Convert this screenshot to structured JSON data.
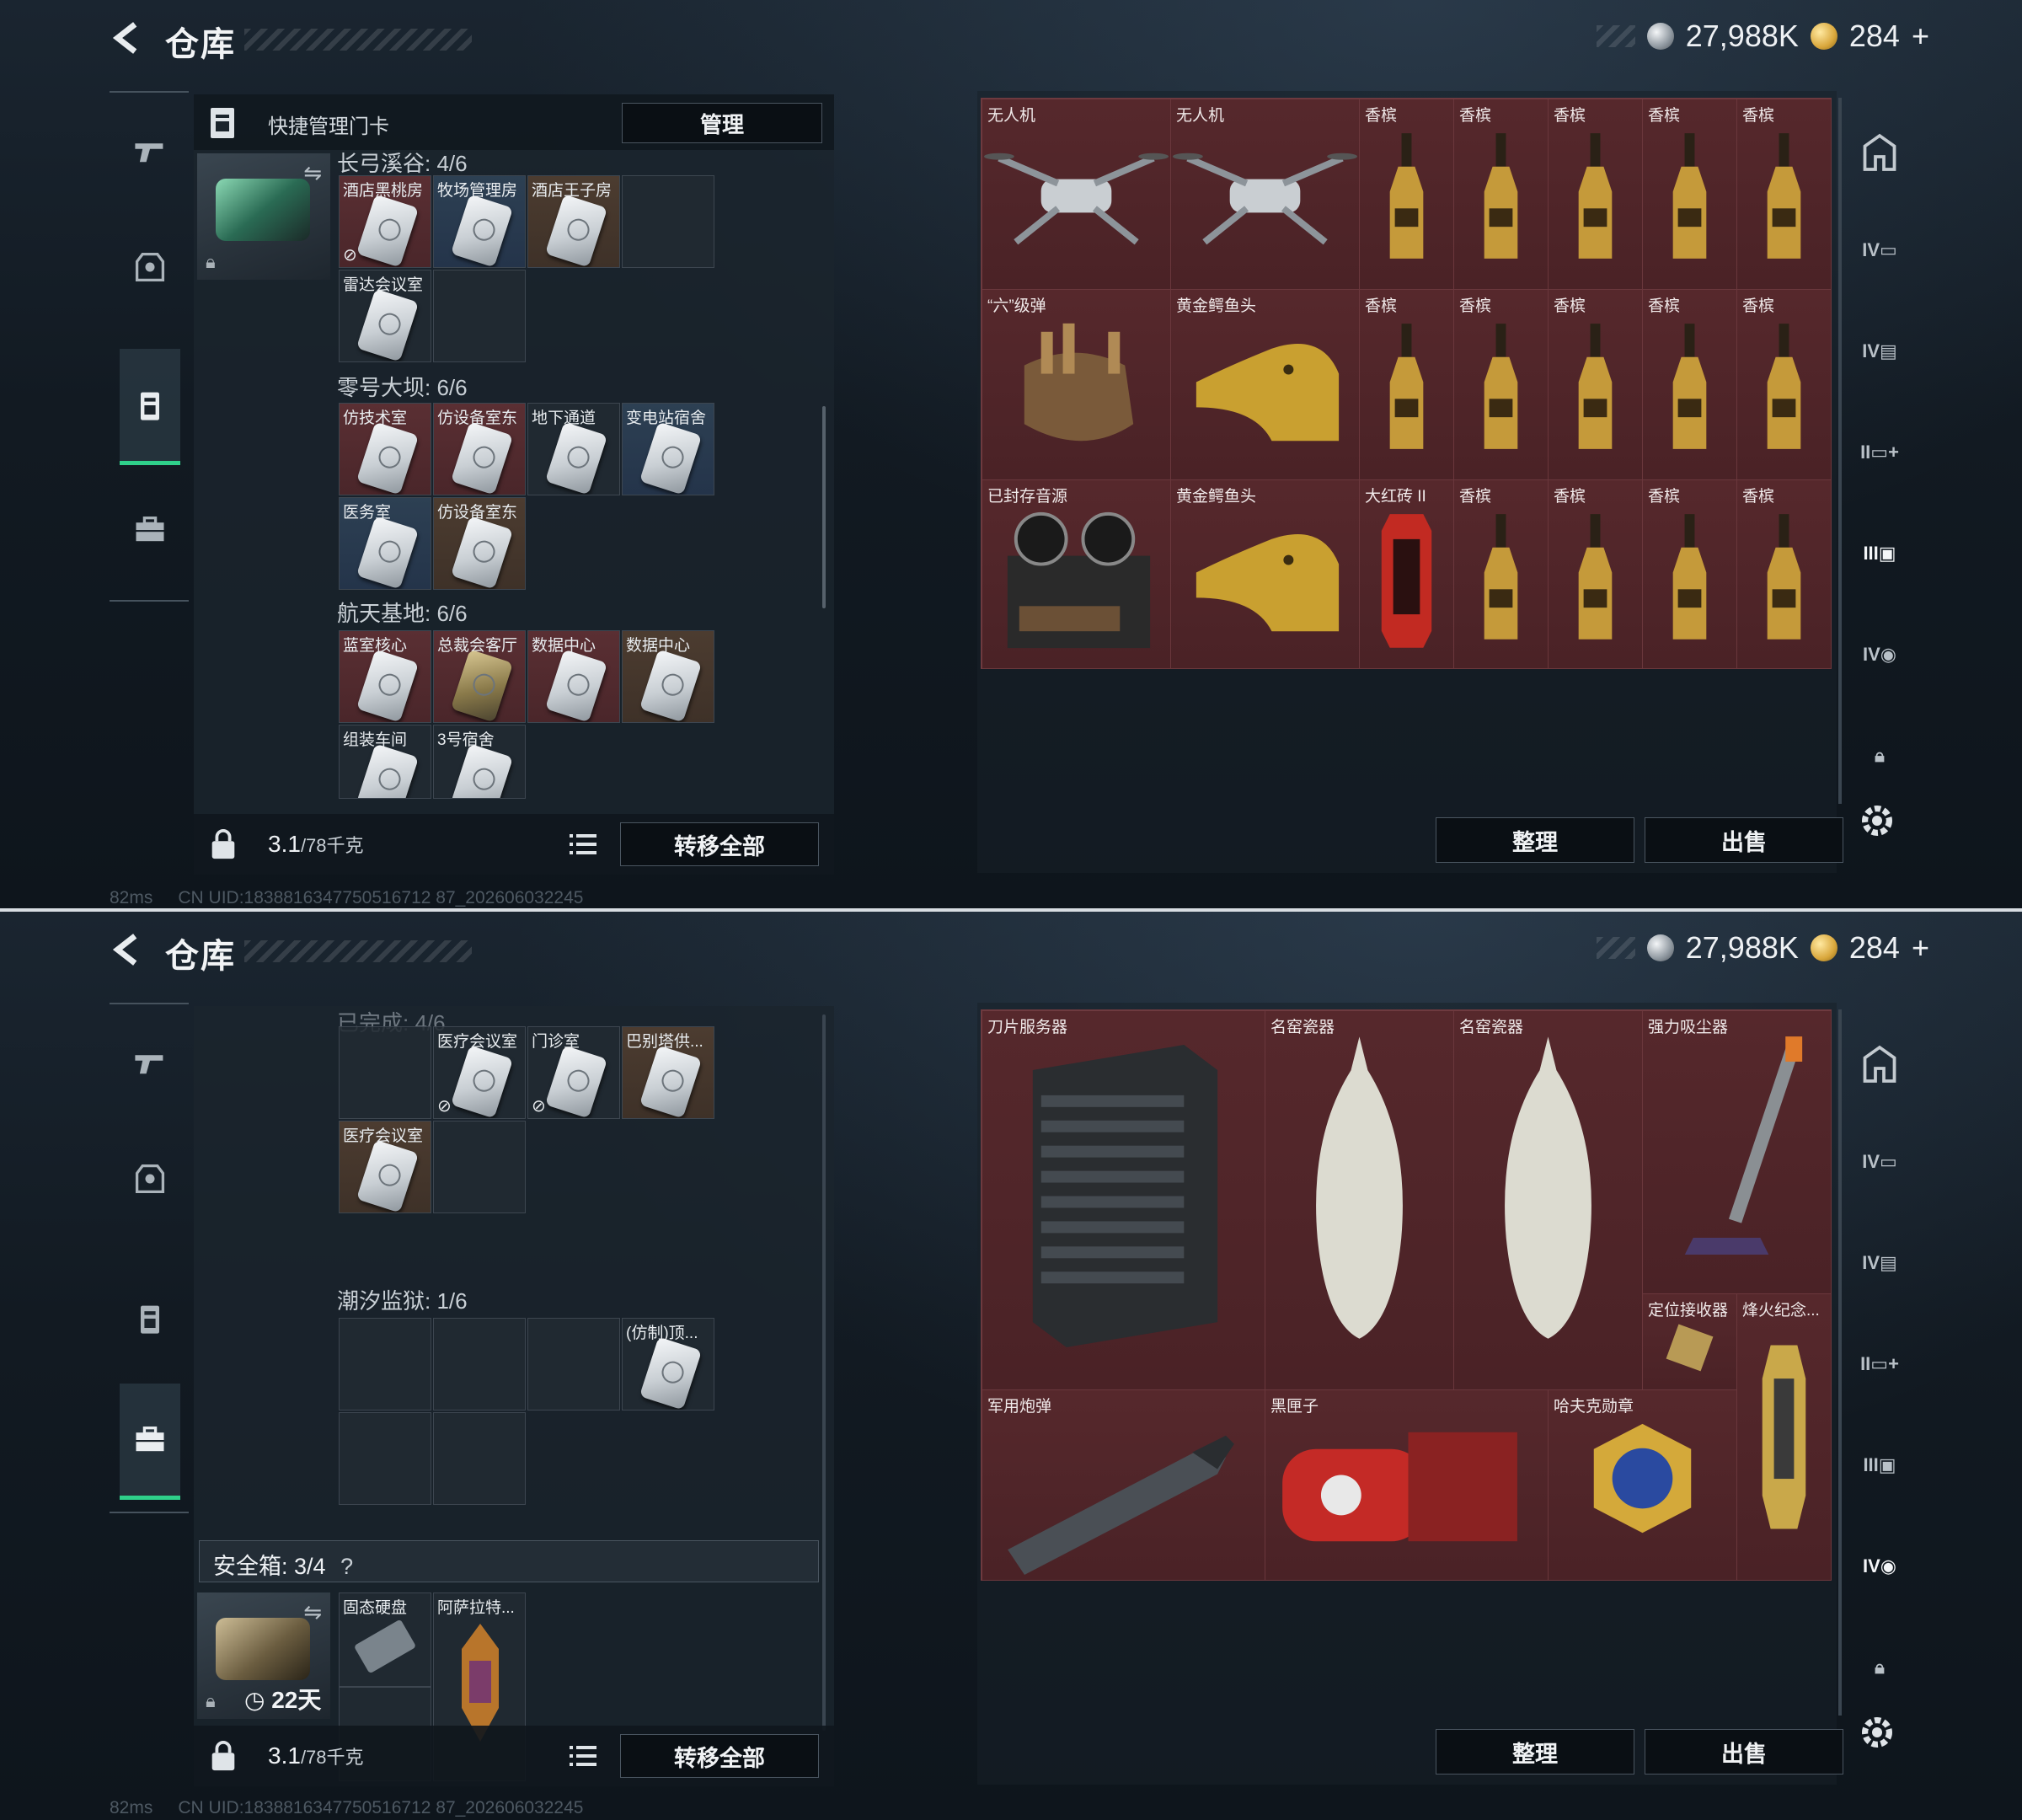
{
  "screens": [
    {
      "title": "仓库",
      "currency": {
        "silver": "27,988K",
        "gold": "284",
        "plus": "+"
      },
      "left_panel": {
        "header": "快捷管理门卡",
        "manage_label": "管理",
        "sections": [
          {
            "label": "长弓溪谷: 4/6"
          },
          {
            "label": "零号大坝: 6/6"
          },
          {
            "label": "航天基地: 6/6"
          }
        ],
        "slots": [
          "酒店黑桃房",
          "牧场管理房",
          "酒店王子房",
          "雷达会议室",
          "仿技术室",
          "仿设备室东",
          "地下通道",
          "变电站宿舍",
          "医务室",
          "仿设备室东",
          "蓝室核心",
          "总裁会客厅",
          "数据中心",
          "数据中心",
          "组装车间",
          "3号宿舍"
        ],
        "weight": "3.1",
        "weight_unit": "/78千克",
        "transfer_label": "转移全部"
      },
      "right_grid": {
        "items": [
          "无人机",
          "无人机",
          "香槟",
          "香槟",
          "香槟",
          "香槟",
          "香槟",
          "“六”级弹",
          "黄金鳄鱼头",
          "香槟",
          "香槟",
          "香槟",
          "香槟",
          "香槟",
          "已封存音源",
          "黄金鳄鱼头",
          "大红砖 II",
          "香槟",
          "香槟",
          "香槟",
          "香槟"
        ]
      },
      "sort_label": "整理",
      "sell_label": "出售",
      "status": {
        "ping": "82ms",
        "uid": "CN UID:1838816347750516712 87_202606032245"
      }
    },
    {
      "title": "仓库",
      "currency": {
        "silver": "27,988K",
        "gold": "284",
        "plus": "+"
      },
      "left_panel": {
        "sections": [
          {
            "label": "已完成: 4/6"
          },
          {
            "label": "潮汐监狱: 1/6"
          }
        ],
        "slots": [
          "医疗会议室",
          "门诊室",
          "巴别塔供...",
          "医疗会议室",
          "(仿制)顶..."
        ],
        "safe_box": {
          "label": "安全箱: 3/4",
          "help": "?",
          "timer": "22天"
        },
        "safe_items": [
          "固态硬盘",
          "阿萨拉特..."
        ],
        "weight": "3.1",
        "weight_unit": "/78千克",
        "transfer_label": "转移全部"
      },
      "right_grid": {
        "items": [
          "刀片服务器",
          "名窑瓷器",
          "名窑瓷器",
          "强力吸尘器",
          "定位接收器",
          "烽火纪念...",
          "军用炮弹",
          "黑匣子",
          "哈夫克勋章"
        ]
      },
      "sort_label": "整理",
      "sell_label": "出售",
      "status": {
        "ping": "82ms",
        "uid": "CN UID:1838816347750516712 87_202606032245"
      }
    }
  ],
  "icons": {
    "back": "back-arrow-icon",
    "weapon": "gun-icon",
    "armor": "armor-icon",
    "keycard": "keycard-icon",
    "briefcase": "briefcase-icon",
    "gear": "gear-icon",
    "lock": "lock-icon",
    "list": "list-icon"
  },
  "colors": {
    "accent_green": "#2fd08a",
    "item_bg": "#4e2428",
    "gold": "#d9a73c"
  }
}
